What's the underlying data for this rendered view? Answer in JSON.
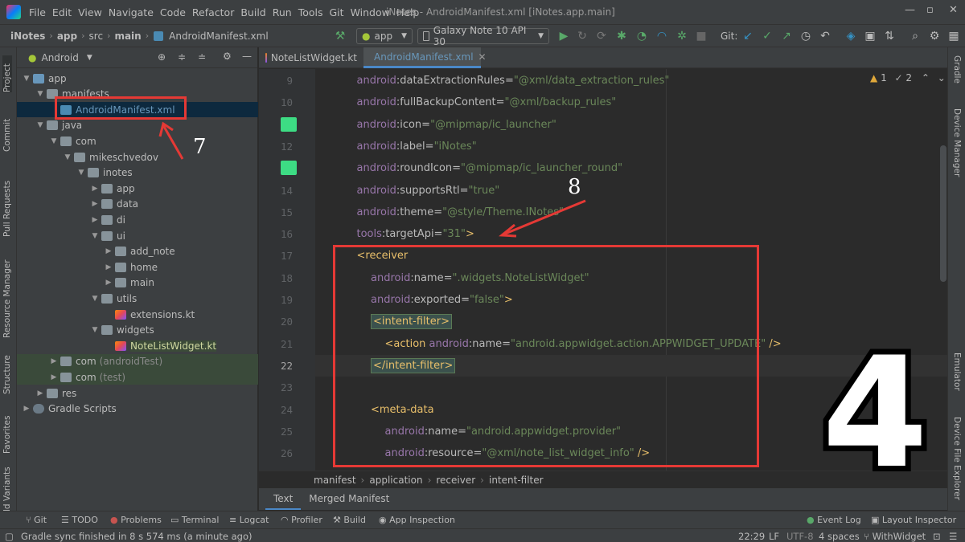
{
  "menubar": {
    "items": [
      "File",
      "Edit",
      "View",
      "Navigate",
      "Code",
      "Refactor",
      "Build",
      "Run",
      "Tools",
      "Git",
      "Window",
      "Help"
    ],
    "title": "iNotes - AndroidManifest.xml [iNotes.app.main]"
  },
  "toolbar": {
    "breadcrumbs": [
      "iNotes",
      "app",
      "src",
      "main",
      "AndroidManifest.xml"
    ],
    "run_config": "app",
    "device": "Galaxy Note  10 API 30",
    "git_label": "Git:"
  },
  "left_tabs": [
    "Project",
    "Commit",
    "Pull Requests",
    "Resource Manager",
    "Structure",
    "Favorites",
    "ld Variants"
  ],
  "right_tabs": [
    "Gradle",
    "Device Manager",
    "Emulator",
    "Device File Explorer"
  ],
  "project": {
    "view": "Android",
    "tree": [
      {
        "label": "app",
        "depth": 0,
        "expanded": true,
        "icon": "module"
      },
      {
        "label": "manifests",
        "depth": 1,
        "expanded": true,
        "icon": "folder"
      },
      {
        "label": "AndroidManifest.xml",
        "depth": 2,
        "icon": "xml",
        "selected": true
      },
      {
        "label": "java",
        "depth": 1,
        "expanded": true,
        "icon": "folder"
      },
      {
        "label": "com",
        "depth": 2,
        "expanded": true,
        "icon": "folder"
      },
      {
        "label": "mikeschvedov",
        "depth": 3,
        "expanded": true,
        "icon": "folder"
      },
      {
        "label": "inotes",
        "depth": 4,
        "expanded": true,
        "icon": "folder"
      },
      {
        "label": "app",
        "depth": 5,
        "expanded": false,
        "icon": "folder"
      },
      {
        "label": "data",
        "depth": 5,
        "expanded": false,
        "icon": "folder"
      },
      {
        "label": "di",
        "depth": 5,
        "expanded": false,
        "icon": "folder"
      },
      {
        "label": "ui",
        "depth": 5,
        "expanded": true,
        "icon": "folder"
      },
      {
        "label": "add_note",
        "depth": 6,
        "expanded": false,
        "icon": "folder"
      },
      {
        "label": "home",
        "depth": 6,
        "expanded": false,
        "icon": "folder"
      },
      {
        "label": "main",
        "depth": 6,
        "expanded": false,
        "icon": "folder"
      },
      {
        "label": "utils",
        "depth": 5,
        "expanded": true,
        "icon": "folder"
      },
      {
        "label": "extensions.kt",
        "depth": 6,
        "icon": "kotlin"
      },
      {
        "label": "widgets",
        "depth": 5,
        "expanded": true,
        "icon": "folder"
      },
      {
        "label": "NoteListWidget.kt",
        "depth": 6,
        "icon": "kotlin",
        "highlight": true
      },
      {
        "label": "com",
        "suffix": "(androidTest)",
        "depth": 2,
        "expanded": false,
        "icon": "folder",
        "test": true
      },
      {
        "label": "com",
        "suffix": "(test)",
        "depth": 2,
        "expanded": false,
        "icon": "folder",
        "test": true
      },
      {
        "label": "res",
        "depth": 1,
        "expanded": false,
        "icon": "folder"
      },
      {
        "label": "Gradle Scripts",
        "depth": 0,
        "expanded": false,
        "icon": "gradle"
      }
    ]
  },
  "editor": {
    "tabs": [
      {
        "label": "NoteListWidget.kt",
        "active": false
      },
      {
        "label": "AndroidManifest.xml",
        "active": true
      }
    ],
    "warnings": "1",
    "weak_warnings": "2",
    "lines": [
      {
        "n": "9",
        "indent": 1,
        "parts": [
          [
            "ns",
            "android"
          ],
          [
            "attr",
            ":dataExtractionRules="
          ],
          [
            "val",
            "\"@xml/data_extraction_rules\""
          ]
        ]
      },
      {
        "n": "10",
        "indent": 1,
        "parts": [
          [
            "ns",
            "android"
          ],
          [
            "attr",
            ":fullBackupContent="
          ],
          [
            "val",
            "\"@xml/backup_rules\""
          ]
        ]
      },
      {
        "n": "11",
        "indent": 1,
        "parts": [
          [
            "ns",
            "android"
          ],
          [
            "attr",
            ":icon="
          ],
          [
            "val",
            "\"@mipmap/ic_launcher\""
          ]
        ]
      },
      {
        "n": "12",
        "indent": 1,
        "parts": [
          [
            "ns",
            "android"
          ],
          [
            "attr",
            ":label="
          ],
          [
            "val",
            "\"iNotes\""
          ]
        ]
      },
      {
        "n": "13",
        "indent": 1,
        "parts": [
          [
            "ns",
            "android"
          ],
          [
            "attr",
            ":roundIcon="
          ],
          [
            "val",
            "\"@mipmap/ic_launcher_round\""
          ]
        ]
      },
      {
        "n": "14",
        "indent": 1,
        "parts": [
          [
            "ns",
            "android"
          ],
          [
            "attr",
            ":supportsRtl="
          ],
          [
            "val",
            "\"true\""
          ]
        ]
      },
      {
        "n": "15",
        "indent": 1,
        "parts": [
          [
            "ns",
            "android"
          ],
          [
            "attr",
            ":theme="
          ],
          [
            "val",
            "\"@style/Theme.INotes\""
          ]
        ]
      },
      {
        "n": "16",
        "indent": 1,
        "parts": [
          [
            "ns",
            "tools"
          ],
          [
            "attr",
            ":targetApi="
          ],
          [
            "val",
            "\"31\""
          ],
          [
            "tag",
            ">"
          ]
        ]
      },
      {
        "n": "17",
        "indent": 1,
        "parts": [
          [
            "tag",
            "<receiver"
          ]
        ]
      },
      {
        "n": "18",
        "indent": 2,
        "parts": [
          [
            "ns",
            "android"
          ],
          [
            "attr",
            ":name="
          ],
          [
            "val",
            "\".widgets.NoteListWidget\""
          ]
        ]
      },
      {
        "n": "19",
        "indent": 2,
        "parts": [
          [
            "ns",
            "android"
          ],
          [
            "attr",
            ":exported="
          ],
          [
            "val",
            "\"false\""
          ],
          [
            "tag",
            ">"
          ]
        ]
      },
      {
        "n": "20",
        "indent": 2,
        "parts": [
          [
            "tagbox",
            "<intent-filter>"
          ]
        ]
      },
      {
        "n": "21",
        "indent": 3,
        "parts": [
          [
            "tag",
            "<action "
          ],
          [
            "ns",
            "android"
          ],
          [
            "attr",
            ":name="
          ],
          [
            "val",
            "\"android.appwidget.action.APPWIDGET_UPDATE\""
          ],
          [
            "tag",
            " />"
          ]
        ]
      },
      {
        "n": "22",
        "indent": 2,
        "parts": [
          [
            "tagbox",
            "</intent-filter>"
          ]
        ]
      },
      {
        "n": "23",
        "indent": 0,
        "parts": []
      },
      {
        "n": "24",
        "indent": 2,
        "parts": [
          [
            "tag",
            "<meta-data"
          ]
        ]
      },
      {
        "n": "25",
        "indent": 3,
        "parts": [
          [
            "ns",
            "android"
          ],
          [
            "attr",
            ":name="
          ],
          [
            "val",
            "\"android.appwidget.provider\""
          ]
        ]
      },
      {
        "n": "26",
        "indent": 3,
        "parts": [
          [
            "ns",
            "android"
          ],
          [
            "attr",
            ":resource="
          ],
          [
            "val",
            "\"@xml/note_list_widget_info\""
          ],
          [
            "tag",
            " />"
          ]
        ]
      }
    ],
    "breadcrumb": [
      "manifest",
      "application",
      "receiver",
      "intent-filter"
    ],
    "subtabs": [
      "Text",
      "Merged Manifest"
    ]
  },
  "toolwindows": [
    "Git",
    "TODO",
    "Problems",
    "Terminal",
    "Logcat",
    "Profiler",
    "Build",
    "App Inspection",
    "Event Log",
    "Layout Inspector"
  ],
  "status": {
    "message": "Gradle sync finished in 8 s 574 ms (a minute ago)",
    "position": "22:29",
    "line_sep": "LF",
    "encoding": "UTF-8",
    "indent": "4 spaces",
    "branch": "WithWidget"
  },
  "annotations": {
    "label_7": "7",
    "label_8": "8",
    "big_label": "4"
  },
  "colors": {
    "annotation_red": "#e53935",
    "bg": "#2b2b2b",
    "panel": "#3c3f41"
  }
}
